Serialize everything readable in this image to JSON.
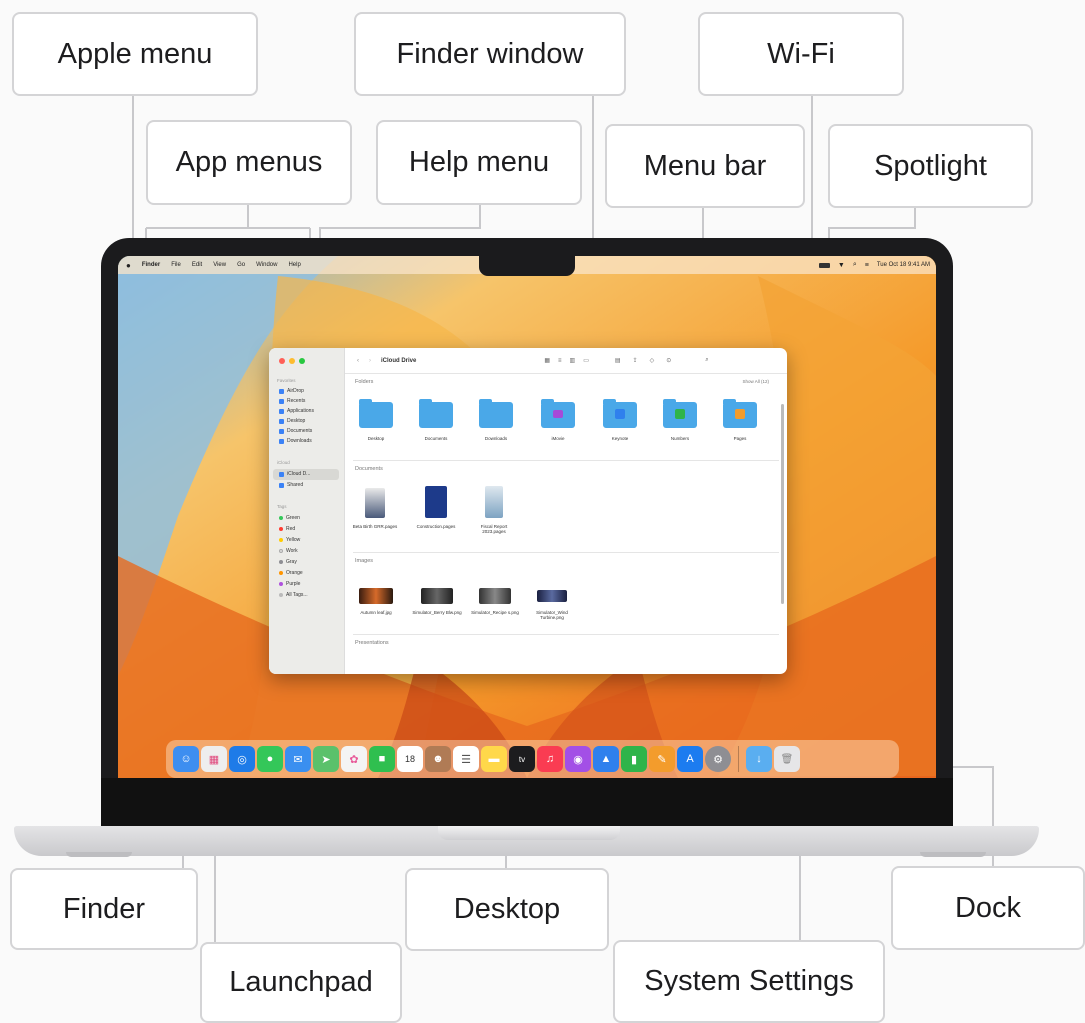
{
  "callouts": {
    "apple_menu": "Apple menu",
    "finder_window": "Finder window",
    "wifi": "Wi-Fi",
    "app_menus": "App menus",
    "help_menu": "Help menu",
    "menu_bar": "Menu bar",
    "spotlight": "Spotlight",
    "finder": "Finder",
    "desktop": "Desktop",
    "dock": "Dock",
    "launchpad": "Launchpad",
    "system_settings": "System Settings"
  },
  "menubar": {
    "app": "Finder",
    "items": [
      "File",
      "Edit",
      "View",
      "Go",
      "Window",
      "Help"
    ],
    "clock": "Tue Oct 18 9:41 AM"
  },
  "finder_window": {
    "path": "iCloud Drive",
    "sidebar": {
      "favorites_header": "Favorites",
      "favorites": [
        "AirDrop",
        "Recents",
        "Applications",
        "Desktop",
        "Documents",
        "Downloads"
      ],
      "icloud_header": "iCloud",
      "icloud": [
        "iCloud D...",
        "Shared"
      ],
      "tags_header": "Tags",
      "tags": [
        {
          "label": "Green",
          "color": "#34c759"
        },
        {
          "label": "Red",
          "color": "#ff3b30"
        },
        {
          "label": "Yellow",
          "color": "#ffcc00"
        },
        {
          "label": "Work",
          "color": "#dddddd"
        },
        {
          "label": "Gray",
          "color": "#8e8e93"
        },
        {
          "label": "Orange",
          "color": "#ff9500"
        },
        {
          "label": "Purple",
          "color": "#af52de"
        },
        {
          "label": "All Tags...",
          "color": "#bbbbbb"
        }
      ]
    },
    "sections": {
      "folders": "Folders",
      "show_all": "Show All (12)",
      "documents": "Documents",
      "images": "Images",
      "presentations": "Presentations"
    },
    "folders": [
      "Desktop",
      "Documents",
      "Downloads",
      "iMovie",
      "Keynote",
      "Numbers",
      "Pages"
    ],
    "documents": [
      "Beta Birth GRR.pages",
      "Construction.pages",
      "Fiscal Report 2023.pages"
    ],
    "images": [
      "Autumn leaf.jpg",
      "Simulator_Berry Blw.png",
      "Simulator_Recipe s.png",
      "Simulator_Wind Turbine.png"
    ]
  },
  "dock_apps": [
    {
      "name": "Finder",
      "color": "#3d8ef0",
      "glyph": "☺"
    },
    {
      "name": "Launchpad",
      "color": "#eeeeee",
      "glyph": "▦"
    },
    {
      "name": "Safari",
      "color": "#1e7be8",
      "glyph": "◎"
    },
    {
      "name": "Messages",
      "color": "#34c759",
      "glyph": "●"
    },
    {
      "name": "Mail",
      "color": "#3a8ff0",
      "glyph": "✉"
    },
    {
      "name": "Maps",
      "color": "#5bc16b",
      "glyph": "➤"
    },
    {
      "name": "Photos",
      "color": "#f4f4f4",
      "glyph": "✿"
    },
    {
      "name": "FaceTime",
      "color": "#2fbf4f",
      "glyph": "■"
    },
    {
      "name": "Calendar",
      "color": "#ffffff",
      "glyph": "18"
    },
    {
      "name": "Contacts",
      "color": "#b07b55",
      "glyph": "☻"
    },
    {
      "name": "Reminders",
      "color": "#ffffff",
      "glyph": "☰"
    },
    {
      "name": "Notes",
      "color": "#ffd84a",
      "glyph": "▬"
    },
    {
      "name": "TV",
      "color": "#1c1c1e",
      "glyph": "tv"
    },
    {
      "name": "Music",
      "color": "#fa3c52",
      "glyph": "♫"
    },
    {
      "name": "Podcasts",
      "color": "#a34fe6",
      "glyph": "◉"
    },
    {
      "name": "Keynote",
      "color": "#2f80ed",
      "glyph": "▲"
    },
    {
      "name": "Numbers",
      "color": "#2fb44a",
      "glyph": "▮"
    },
    {
      "name": "Pages",
      "color": "#f39c2c",
      "glyph": "✎"
    },
    {
      "name": "App Store",
      "color": "#1c7cf0",
      "glyph": "A"
    },
    {
      "name": "System Settings",
      "color": "#8e8e93",
      "glyph": "⚙"
    },
    {
      "name": "Downloads",
      "color": "#5aaef0",
      "glyph": "↓"
    },
    {
      "name": "Trash",
      "color": "#e6e6e8",
      "glyph": "🗑"
    }
  ]
}
